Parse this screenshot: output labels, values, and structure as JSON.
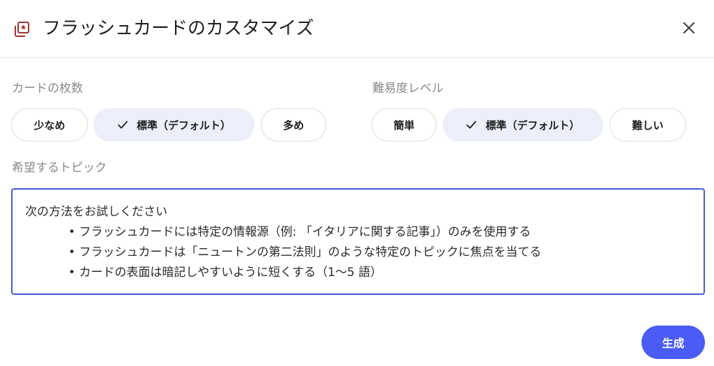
{
  "header": {
    "title": "フラッシュカードのカスタマイズ",
    "icon": "flashcard-icon",
    "icon_color": "#a4322c"
  },
  "card_count": {
    "label": "カードの枚数",
    "options": [
      "少なめ",
      "標準（デフォルト）",
      "多め"
    ],
    "selected": "標準（デフォルト）"
  },
  "difficulty": {
    "label": "難易度レベル",
    "options": [
      "簡単",
      "標準（デフォルト）",
      "難しい"
    ],
    "selected": "標準（デフォルト）"
  },
  "topic": {
    "label": "希望するトピック",
    "intro": "次の方法をお試しください",
    "bullets": [
      "• フラッシュカードには特定の情報源（例: 「イタリアに関する記事」）のみを使用する",
      "• フラッシュカードは「ニュートンの第二法則」のような特定のトピックに焦点を当てる",
      "• カードの表面は暗記しやすいように短くする（1〜5 語）"
    ]
  },
  "actions": {
    "generate_label": "生成"
  },
  "colors": {
    "accent": "#4a5cf5",
    "focus_border": "#4657d6",
    "selected_chip": "#eceff9"
  }
}
